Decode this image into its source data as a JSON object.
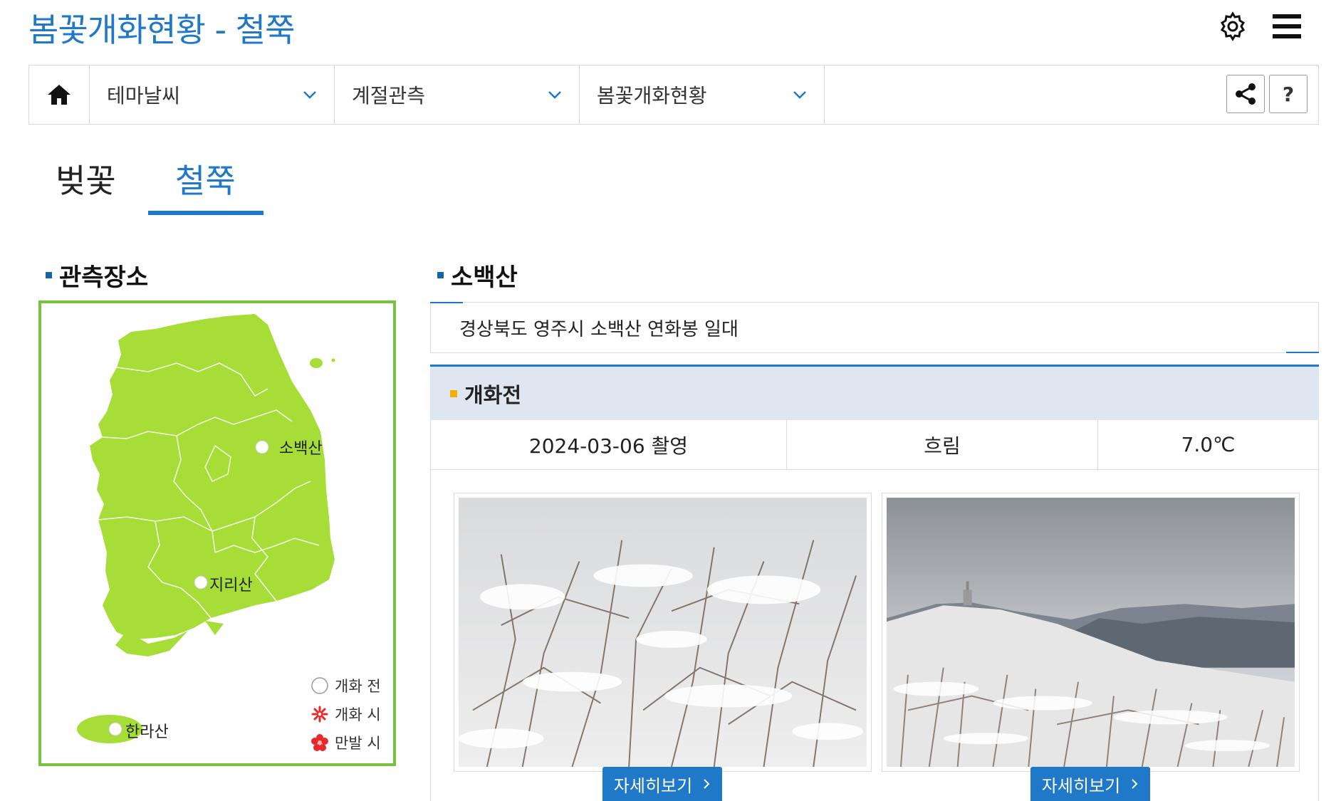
{
  "header": {
    "title": "봄꽃개화현황 - 철쭉",
    "settings_icon": "gear-icon",
    "menu_icon": "hamburger-icon"
  },
  "nav": {
    "home_icon": "home-icon",
    "items": [
      {
        "label": "테마날씨"
      },
      {
        "label": "계절관측"
      },
      {
        "label": "봄꽃개화현황"
      }
    ],
    "share_icon": "share-icon",
    "help_label": "?"
  },
  "tabs": [
    {
      "label": "벚꽃",
      "active": false
    },
    {
      "label": "철쭉",
      "active": true
    }
  ],
  "left": {
    "section_title": "관측장소",
    "locations": [
      {
        "name": "소백산"
      },
      {
        "name": "지리산"
      },
      {
        "name": "한라산"
      }
    ],
    "legend": [
      {
        "label": "개화 전",
        "icon": "empty-circle-icon"
      },
      {
        "label": "개화 시",
        "icon": "flower-outline-icon"
      },
      {
        "label": "만발 시",
        "icon": "flower-full-icon"
      }
    ],
    "colors": {
      "map_fill": "#a6dd37",
      "border": "#79c23f"
    }
  },
  "right": {
    "section_title": "소백산",
    "address": "경상북도 영주시 소백산 연화봉 일대",
    "status": "개화전",
    "date": "2024-03-06 촬영",
    "weather": "흐림",
    "temperature": "7.0℃",
    "photos": [
      {
        "button_label": "자세히보기"
      },
      {
        "button_label": "자세히보기"
      }
    ]
  },
  "colors": {
    "accent": "#1f78c8",
    "status_bg": "#dde6f1",
    "status_marker": "#f0b100"
  }
}
